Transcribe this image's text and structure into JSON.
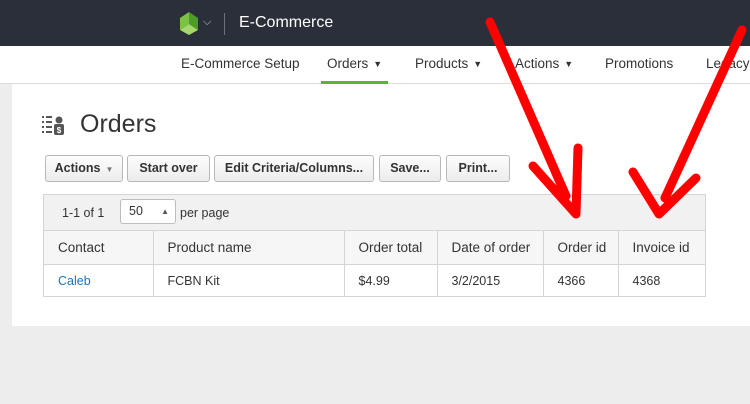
{
  "header": {
    "app_title": "E-Commerce"
  },
  "nav": {
    "items": [
      {
        "label": "E-Commerce Setup"
      },
      {
        "label": "Orders"
      },
      {
        "label": "Products"
      },
      {
        "label": "Actions"
      },
      {
        "label": "Promotions"
      },
      {
        "label": "Legacy"
      }
    ]
  },
  "page": {
    "title": "Orders"
  },
  "toolbar": {
    "actions_label": "Actions",
    "start_over_label": "Start over",
    "edit_criteria_label": "Edit Criteria/Columns...",
    "save_label": "Save...",
    "print_label": "Print..."
  },
  "pager": {
    "count_text": "1-1 of 1",
    "page_size": "50",
    "per_page_label": "per page"
  },
  "table": {
    "columns": [
      "Contact",
      "Product name",
      "Order total",
      "Date of order",
      "Order id",
      "Invoice id"
    ],
    "rows": [
      [
        "Caleb",
        "FCBN Kit",
        "$4.99",
        "3/2/2015",
        "4366",
        "4368"
      ]
    ]
  },
  "colors": {
    "accent": "#5bb339",
    "link": "#1f73b7",
    "arrow": "#ff0000",
    "topbar": "#2b2f3a"
  }
}
